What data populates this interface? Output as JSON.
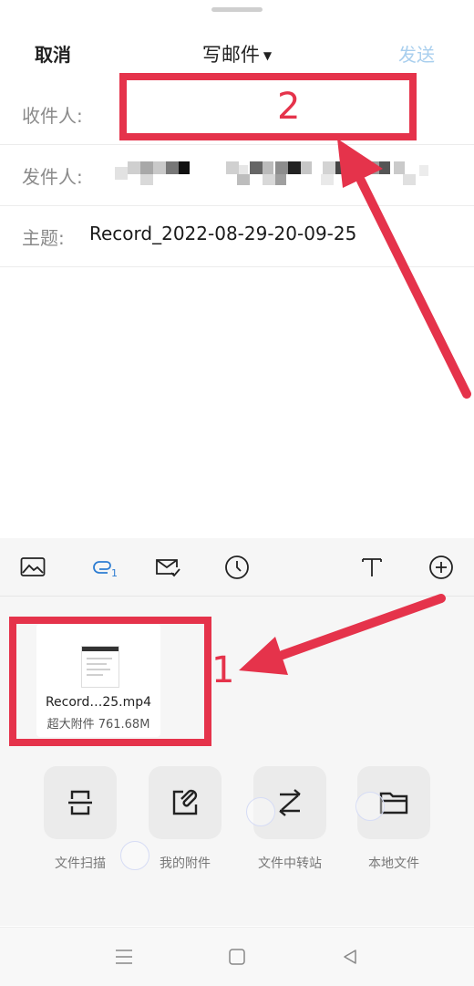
{
  "header": {
    "cancel_label": "取消",
    "title": "写邮件",
    "send_label": "发送"
  },
  "fields": {
    "to_label": "收件人:",
    "to_value": "",
    "from_label": "发件人:",
    "subject_label": "主题:",
    "subject_value": "Record_2022-08-29-20-09-25"
  },
  "toolbar": {
    "attachment_count": "1",
    "icons": [
      "image-icon",
      "attachment-icon",
      "mail-check-icon",
      "clock-icon",
      "text-format-icon",
      "plus-circle-icon"
    ]
  },
  "attachment": {
    "filename": "Record…25.mp4",
    "meta": "超大附件 761.68M"
  },
  "options": [
    {
      "label": "文件扫描",
      "icon": "scan-icon"
    },
    {
      "label": "我的附件",
      "icon": "my-attachment-icon"
    },
    {
      "label": "文件中转站",
      "icon": "transfer-icon"
    },
    {
      "label": "本地文件",
      "icon": "folder-icon"
    }
  ],
  "annotations": {
    "marker_1": "1",
    "marker_2": "2",
    "color": "#e5334b"
  },
  "colors": {
    "accent": "#2d7dd2",
    "send_disabled": "#a9cfee"
  }
}
